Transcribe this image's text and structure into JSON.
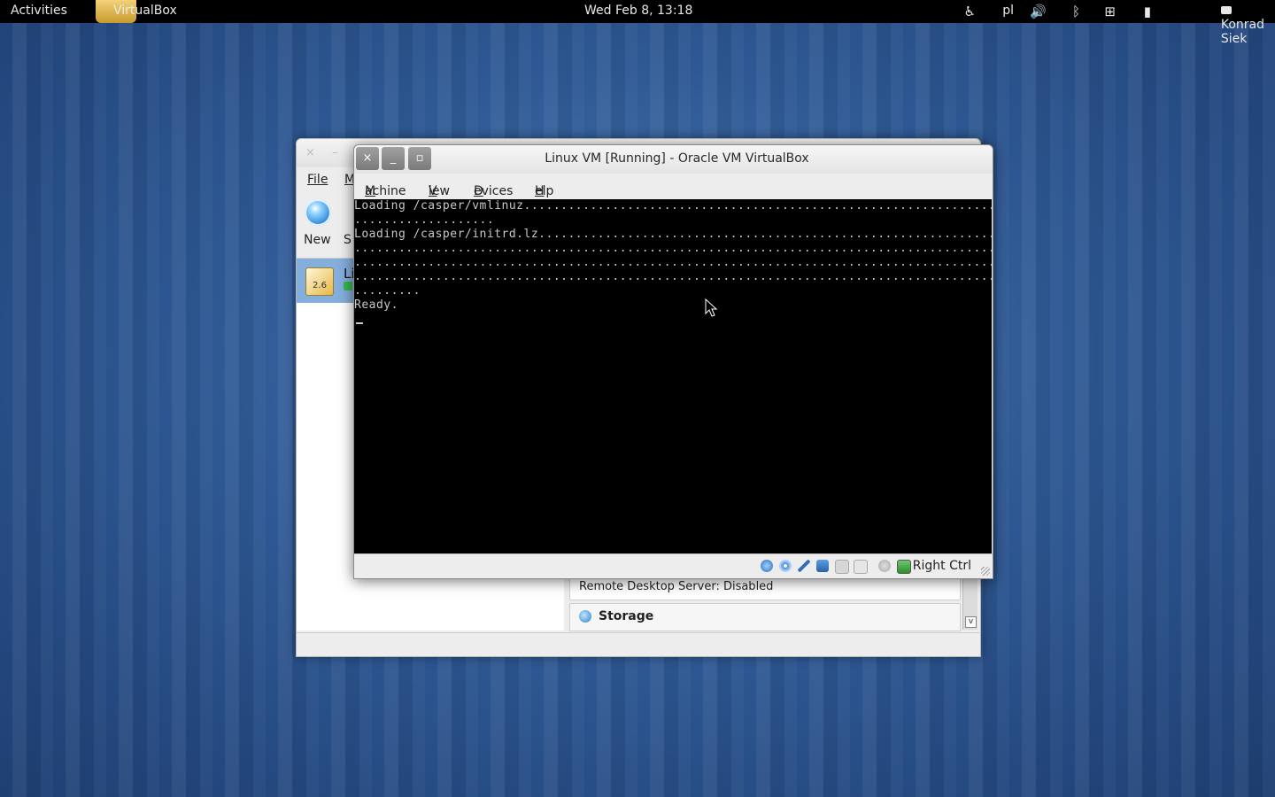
{
  "topbar": {
    "activities": "Activities",
    "app_name": "VirtualBox",
    "clock": "Wed Feb  8, 13:18",
    "keyboard_layout": "pl",
    "user_name": "Konrad Siek",
    "icons": [
      "accessibility-icon",
      "volume-icon",
      "bluetooth-icon",
      "network-icon",
      "battery-icon",
      "chat-icon"
    ]
  },
  "manager": {
    "menu": {
      "file": "File",
      "machine_partial": "M"
    },
    "toolbar": {
      "new_label": "New",
      "settings_partial": "S"
    },
    "vm_list": {
      "first_letter": "Li",
      "os_version": "2.6"
    },
    "details": {
      "remote_desktop": "Remote Desktop Server: Disabled",
      "storage": "Storage"
    },
    "window_controls": {
      "close": "×",
      "minimize": "–"
    }
  },
  "vm_window": {
    "title": "Linux VM [Running] - Oracle VM VirtualBox",
    "controls": {
      "close": "×",
      "minimize": "_",
      "maximize": "▫"
    },
    "menu": {
      "machine": "Machine",
      "view": "View",
      "devices": "Devices",
      "help": "Help"
    },
    "console_lines": [
      "Loading /casper/vmlinuz.................................................................",
      "...................",
      "Loading /casper/initrd.lz...............................................................",
      "........................................................................................",
      "........................................................................................",
      "........................................................................................",
      ".........",
      "Ready."
    ],
    "status": {
      "host_key": "Right Ctrl",
      "icons": [
        "hard-disk-icon",
        "optical-drive-icon",
        "usb-icon",
        "network-adapter-icon",
        "shared-folders-icon",
        "display-icon",
        "mouse-integration-icon",
        "keyboard-capture-icon"
      ]
    }
  }
}
